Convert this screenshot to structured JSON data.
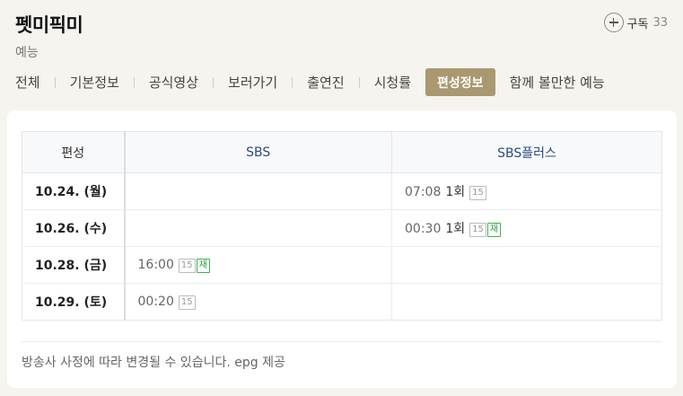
{
  "header": {
    "title": "펫미픽미",
    "genre": "예능",
    "subscribe_label": "구독",
    "subscribe_count": "33"
  },
  "tabs": [
    {
      "label": "전체"
    },
    {
      "label": "기본정보"
    },
    {
      "label": "공식영상"
    },
    {
      "label": "보러가기"
    },
    {
      "label": "출연진"
    },
    {
      "label": "시청률"
    },
    {
      "label": "편성정보",
      "active": true
    },
    {
      "label": "함께 볼만한 예능"
    }
  ],
  "schedule": {
    "headers": [
      "편성",
      "SBS",
      "SBS플러스"
    ],
    "rows": [
      {
        "date": "10.24. (월)",
        "sbs": null,
        "sbs_plus": {
          "time": "07:08",
          "episode": "1회",
          "rating": "15",
          "rerun": false
        }
      },
      {
        "date": "10.26. (수)",
        "sbs": null,
        "sbs_plus": {
          "time": "00:30",
          "episode": "1회",
          "rating": "15",
          "rerun": true
        }
      },
      {
        "date": "10.28. (금)",
        "sbs": {
          "time": "16:00",
          "episode": "",
          "rating": "15",
          "rerun": true
        },
        "sbs_plus": null
      },
      {
        "date": "10.29. (토)",
        "sbs": {
          "time": "00:20",
          "episode": "",
          "rating": "15",
          "rerun": false
        },
        "sbs_plus": null
      }
    ],
    "rerun_label": "재"
  },
  "notice": "방송사 사정에 따라 변경될 수 있습니다. epg 제공",
  "colors": {
    "active_tab": "#a99870",
    "header_text": "#2b4b7e",
    "rerun_badge": "#3bb54a"
  }
}
